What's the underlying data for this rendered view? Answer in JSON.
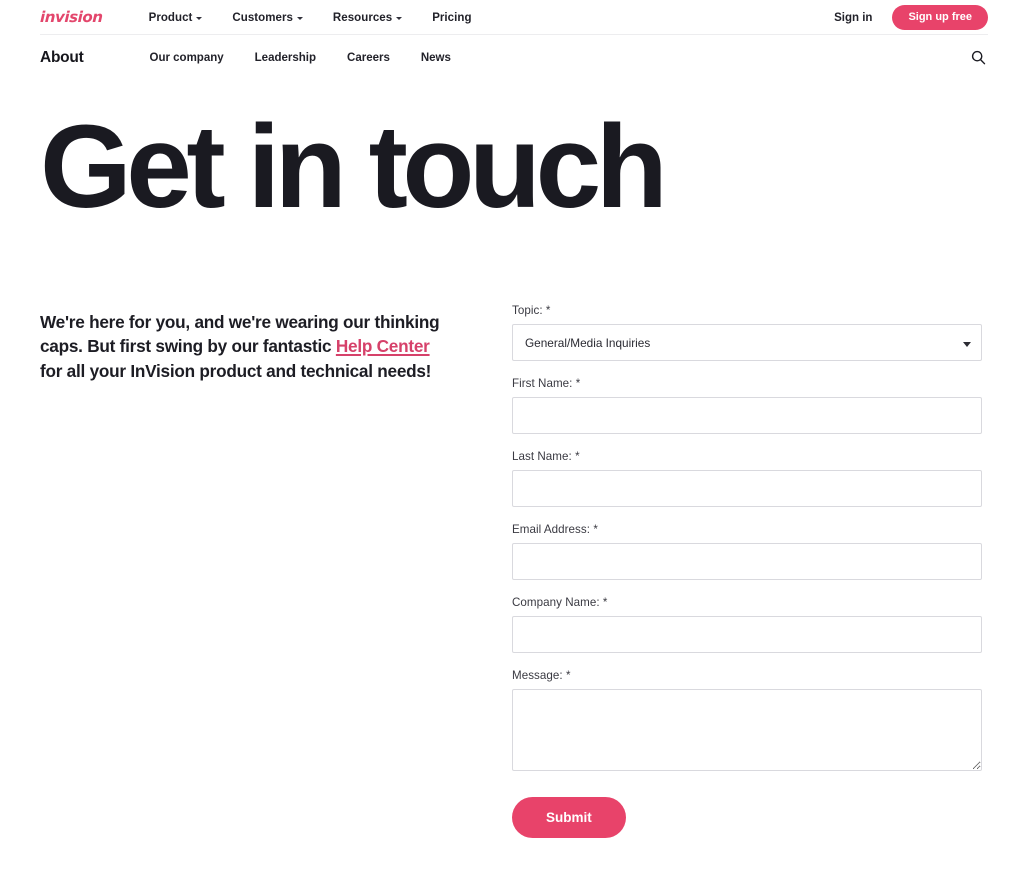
{
  "topnav": {
    "logo": "invision",
    "links": [
      {
        "label": "Product",
        "has_chevron": true,
        "icon": "chevron-down-icon"
      },
      {
        "label": "Customers",
        "has_chevron": true,
        "icon": "chevron-down-icon"
      },
      {
        "label": "Resources",
        "has_chevron": true,
        "icon": "chevron-down-icon"
      },
      {
        "label": "Pricing",
        "has_chevron": false,
        "icon": ""
      }
    ],
    "sign_in": "Sign in",
    "sign_up": "Sign up free"
  },
  "subnav": {
    "title": "About",
    "links": [
      {
        "label": "Our company"
      },
      {
        "label": "Leadership"
      },
      {
        "label": "Careers"
      },
      {
        "label": "News"
      }
    ],
    "search_icon": "search-icon"
  },
  "hero": {
    "heading": "Get in touch"
  },
  "intro": {
    "text_before": "We're here for you, and we're wearing our thinking caps. But first swing by our fantastic ",
    "link_text": "Help Center",
    "text_after": " for all your InVision product and technical needs!"
  },
  "form": {
    "topic": {
      "label": "Topic:",
      "required_mark": "*",
      "value": "General/Media Inquiries",
      "options": [
        "General/Media Inquiries"
      ]
    },
    "first_name": {
      "label": "First Name:",
      "required_mark": "*",
      "value": "",
      "placeholder": ""
    },
    "last_name": {
      "label": "Last Name:",
      "required_mark": "*",
      "value": "",
      "placeholder": ""
    },
    "email": {
      "label": "Email Address:",
      "required_mark": "*",
      "value": "",
      "placeholder": ""
    },
    "company": {
      "label": "Company Name:",
      "required_mark": "*",
      "value": "",
      "placeholder": ""
    },
    "message": {
      "label": "Message:",
      "required_mark": "*",
      "value": "",
      "placeholder": ""
    },
    "submit_label": "Submit"
  },
  "colors": {
    "accent_pink": "#e8436a",
    "link_pink": "#d6416a",
    "text_dark": "#1a1a21",
    "border_grey": "#d9d9de",
    "background": "#ffffff"
  }
}
